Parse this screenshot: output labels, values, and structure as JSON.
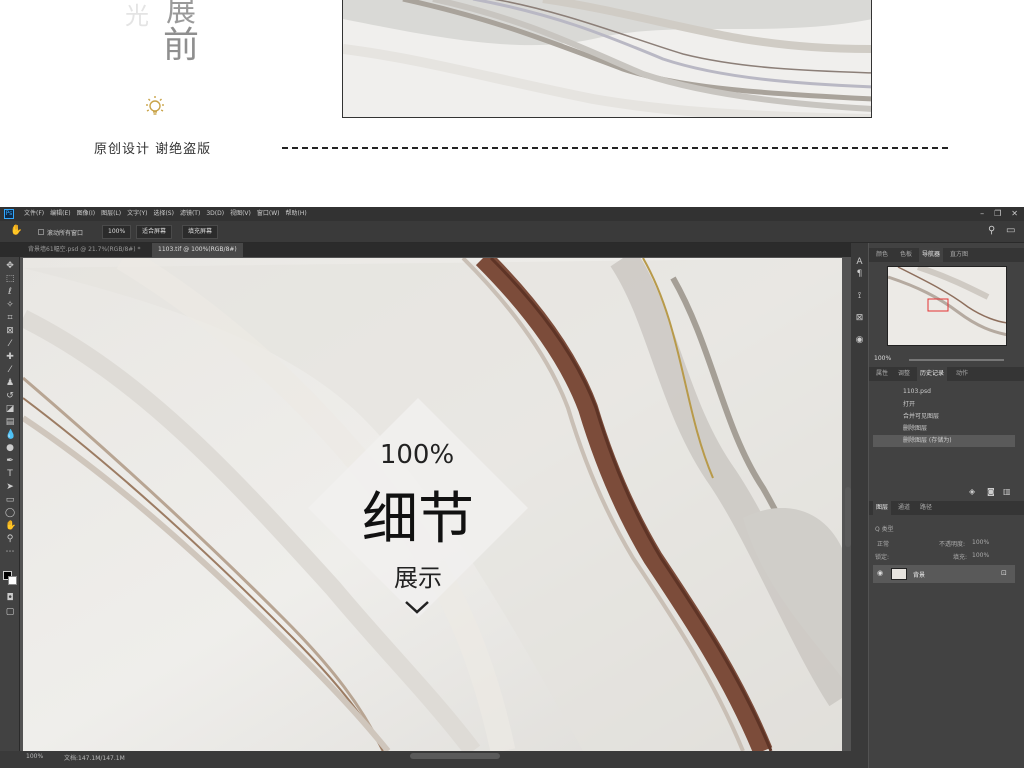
{
  "top": {
    "vertical_char_light": "光",
    "vertical_char_partial": "展",
    "vertical_char_main": "前",
    "tagline": "原创设计 谢绝盗版"
  },
  "app": {
    "logo": "Ps",
    "menu": [
      "文件(F)",
      "编辑(E)",
      "图像(I)",
      "图层(L)",
      "文字(Y)",
      "选择(S)",
      "滤镜(T)",
      "3D(D)",
      "视图(V)",
      "窗口(W)",
      "帮助(H)"
    ],
    "options": {
      "checkbox_label": "滚动所有窗口",
      "zoom": "100%",
      "fit_screen": "适合屏幕",
      "fill_screen": "填充屏幕"
    },
    "tabs": [
      "背景墙61幅空.psd @ 21.7%(RGB/8#) *",
      "1103.tif @ 100%(RGB/8#)"
    ],
    "status": {
      "zoom": "100%",
      "doc": "文档:147.1M/147.1M"
    }
  },
  "overlay": {
    "percent": "100%",
    "big": "细节",
    "sub": "展示"
  },
  "panels": {
    "top_tabs": [
      "颜色",
      "色板",
      "导航器",
      "直方图"
    ],
    "nav_zoom": "100%",
    "mid_tabs": [
      "属性",
      "调整",
      "历史记录",
      "动作"
    ],
    "history_file": "1103.psd",
    "history": [
      "打开",
      "合并可见图层",
      "删除图层",
      "删除图层 (存储为)"
    ],
    "layer_tabs": [
      "图层",
      "通道",
      "路径"
    ],
    "layer_kind": "Q 类型",
    "blend": "正常",
    "opacity_label": "不透明度:",
    "opacity": "100%",
    "lock_label": "锁定:",
    "fill_label": "填充:",
    "fill": "100%",
    "layer_name": "背景"
  }
}
